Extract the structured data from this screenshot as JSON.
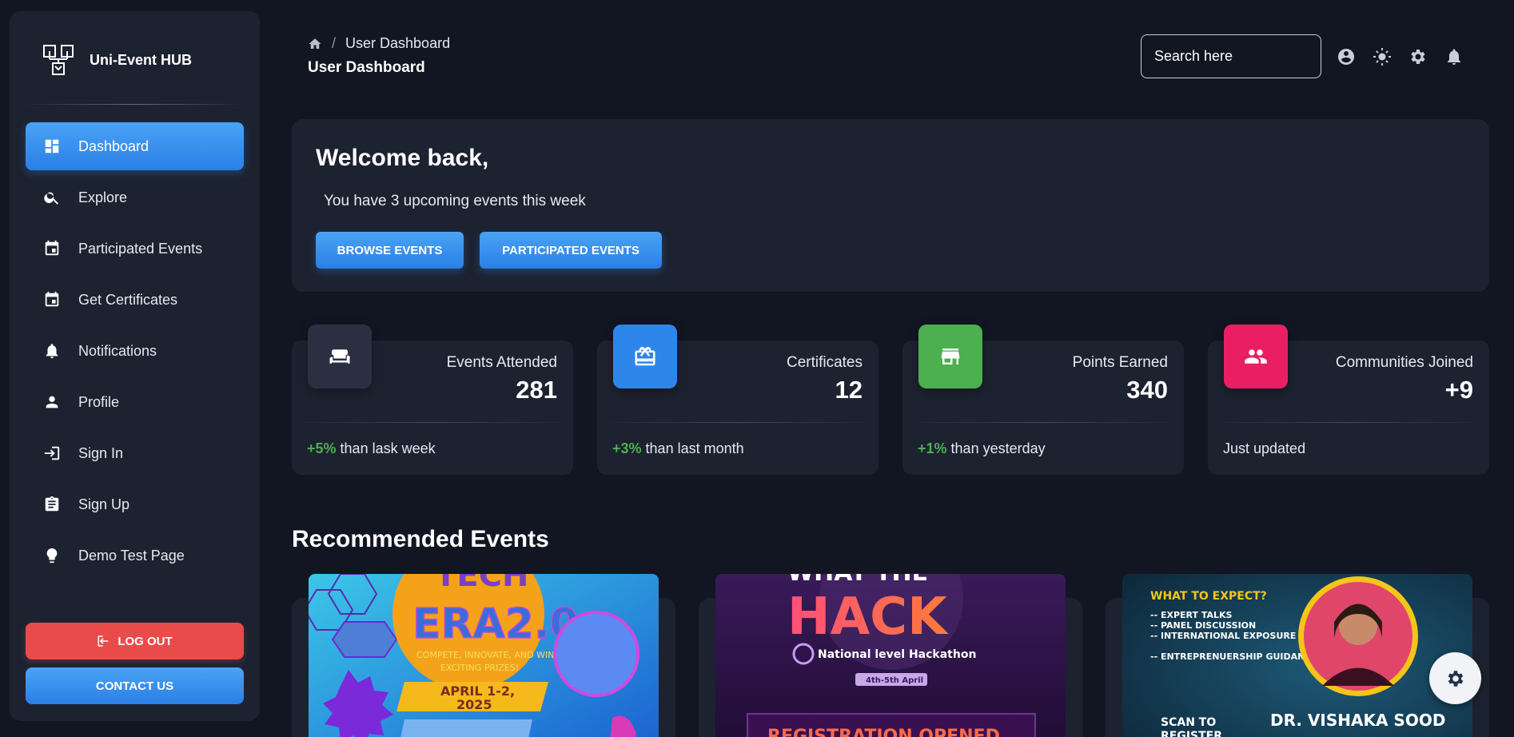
{
  "brand": {
    "name": "Uni-Event HUB"
  },
  "sidebar": {
    "items": [
      {
        "label": "Dashboard",
        "icon": "dashboard-icon",
        "active": true
      },
      {
        "label": "Explore",
        "icon": "search-icon"
      },
      {
        "label": "Participated Events",
        "icon": "calendar-icon"
      },
      {
        "label": "Get Certificates",
        "icon": "calendar-icon"
      },
      {
        "label": "Notifications",
        "icon": "bell-icon"
      },
      {
        "label": "Profile",
        "icon": "person-icon"
      },
      {
        "label": "Sign In",
        "icon": "login-icon"
      },
      {
        "label": "Sign Up",
        "icon": "clipboard-icon"
      },
      {
        "label": "Demo Test Page",
        "icon": "lightbulb-icon"
      }
    ],
    "logout_label": "LOG OUT",
    "contact_label": "CONTACT US"
  },
  "header": {
    "breadcrumb_current": "User Dashboard",
    "page_title": "User Dashboard",
    "search_placeholder": "Search here"
  },
  "welcome": {
    "title": "Welcome back,",
    "subtitle": "You have 3 upcoming events this week",
    "browse_label": "BROWSE EVENTS",
    "participated_label": "PARTICIPATED EVENTS"
  },
  "stats": [
    {
      "label": "Events Attended",
      "value": "281",
      "change": "+5%",
      "note": "than lask week",
      "color": "#2a3042",
      "icon": "sofa-icon"
    },
    {
      "label": "Certificates",
      "value": "12",
      "change": "+3%",
      "note": "than last month",
      "color": "#2f86ea",
      "icon": "certificate-icon"
    },
    {
      "label": "Points Earned",
      "value": "340",
      "change": "+1%",
      "note": "than yesterday",
      "color": "#4caf50",
      "icon": "store-icon"
    },
    {
      "label": "Communities Joined",
      "value": "+9",
      "change": "",
      "note": "Just updated",
      "color": "#e91e63",
      "icon": "people-icon"
    }
  ],
  "recommended": {
    "title": "Recommended Events",
    "events": [
      {
        "image": "tech-era-poster",
        "headline_top": "TECH",
        "headline": "ERA2.0",
        "tagline": "COMPETE, INNOVATE, AND WIN EXCITING PRIZES!",
        "date": "APRIL 1-2, 2025"
      },
      {
        "image": "hackathon-poster",
        "headline_top": "WHAT THE",
        "headline": "HACK",
        "tagline": "National level Hackathon",
        "date": "4th-5th April",
        "banner": "REGISTRATION OPENED"
      },
      {
        "image": "speaker-poster",
        "heading": "WHAT TO EXPECT?",
        "points": [
          "-- EXPERT TALKS",
          "-- PANEL DISCUSSION",
          "-- INTERNATIONAL EXPOSURE",
          "-- ENTREPRENUERSHIP GUIDANCE"
        ],
        "scan": "SCAN TO REGISTER",
        "speaker": "DR. VISHAKA SOOD"
      }
    ]
  }
}
